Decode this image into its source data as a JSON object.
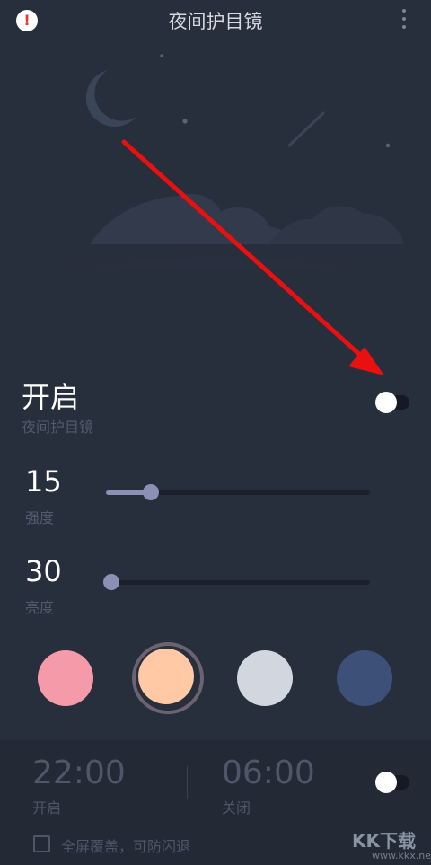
{
  "header": {
    "title": "夜间护目镜",
    "alert_icon": "exclamation-circle-icon",
    "menu_icon": "more-vertical-icon"
  },
  "main_toggle": {
    "label": "开启",
    "sublabel": "夜间护目镜",
    "on": false
  },
  "sliders": [
    {
      "value": "15",
      "label": "强度",
      "level": 0.17
    },
    {
      "value": "30",
      "label": "亮度",
      "level": 0.02
    }
  ],
  "swatches": [
    {
      "color": "#f49aa8",
      "selected": false
    },
    {
      "color": "#ffc9a6",
      "selected": true
    },
    {
      "color": "#d2d6de",
      "selected": false
    },
    {
      "color": "#3d5078",
      "selected": false
    }
  ],
  "schedule": {
    "start_time": "22:00",
    "start_label": "开启",
    "end_time": "06:00",
    "end_label": "关闭",
    "enabled": false
  },
  "fullscreen": {
    "label": "全屏覆盖，可防闪退",
    "checked": false
  },
  "watermark": {
    "text": "KK下载",
    "url": "www.kkx.net"
  },
  "colors": {
    "background": "#272e3c",
    "footer": "#232a36",
    "slider_accent": "#8b90b5",
    "annotation_arrow": "#e81010"
  }
}
